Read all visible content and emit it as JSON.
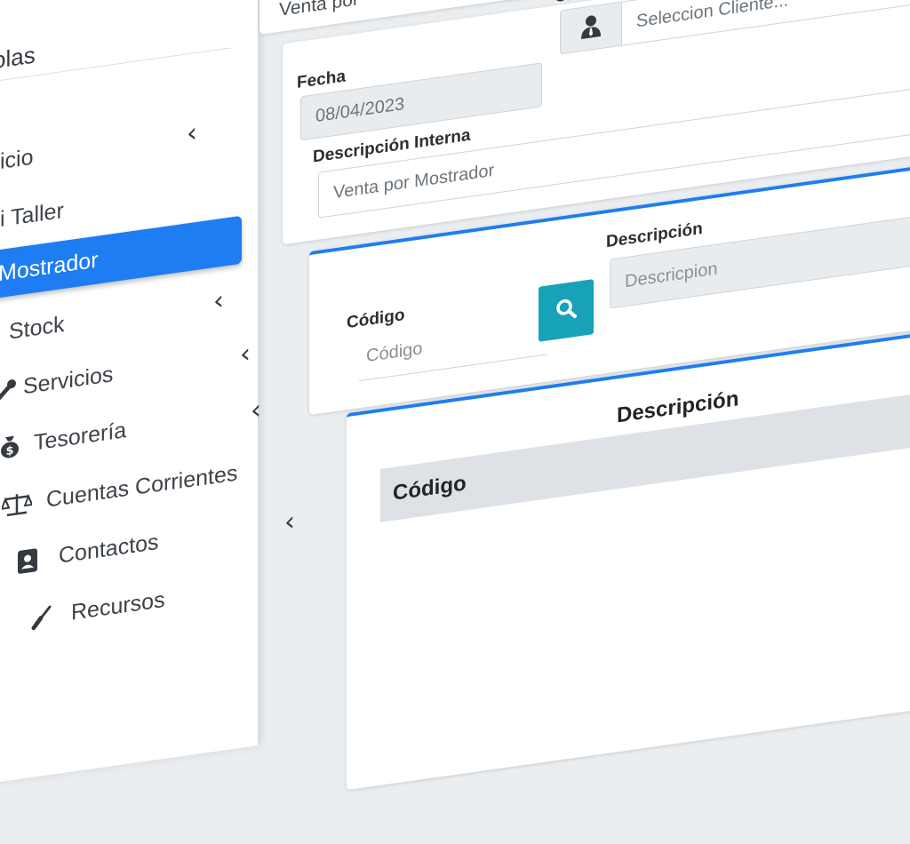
{
  "sidebar": {
    "top_partial": "olas",
    "items": [
      {
        "label": "icio",
        "chevron": "‹",
        "icon": ""
      },
      {
        "label": "i Taller",
        "chevron": "",
        "icon": ""
      },
      {
        "label": "Mostrador",
        "chevron": "",
        "icon": "",
        "active": true
      },
      {
        "label": "Stock",
        "chevron": "‹",
        "icon": ""
      },
      {
        "label": "Servicios",
        "chevron": "‹",
        "icon": "wrench-icon"
      },
      {
        "label": "Tesorería",
        "chevron": "‹",
        "icon": "money-bag-icon"
      },
      {
        "label": "Cuentas Corrientes",
        "chevron": "",
        "icon": "scale-icon"
      },
      {
        "label": "Contactos",
        "chevron": "‹",
        "icon": "address-book-icon"
      },
      {
        "label": "Recursos",
        "chevron": "",
        "icon": "tools-icon"
      }
    ]
  },
  "header_partial": "Venta por",
  "form": {
    "fecha_label": "Fecha",
    "fecha_value": "08/04/2023",
    "cliente_label": "Cliente",
    "cliente_placeholder": "Seleccion Cliente...",
    "desc_interna_label": "Descripción Interna",
    "desc_interna_value": "Venta por Mostrador"
  },
  "item_search": {
    "codigo_label": "Código",
    "codigo_placeholder": "Código",
    "descripcion_label": "Descripción",
    "descripcion_placeholder": "Descricpion"
  },
  "table": {
    "headers": [
      "Código",
      "Descripción"
    ]
  },
  "colors": {
    "primary": "#1e7df2",
    "search_button": "#17a2b8"
  }
}
